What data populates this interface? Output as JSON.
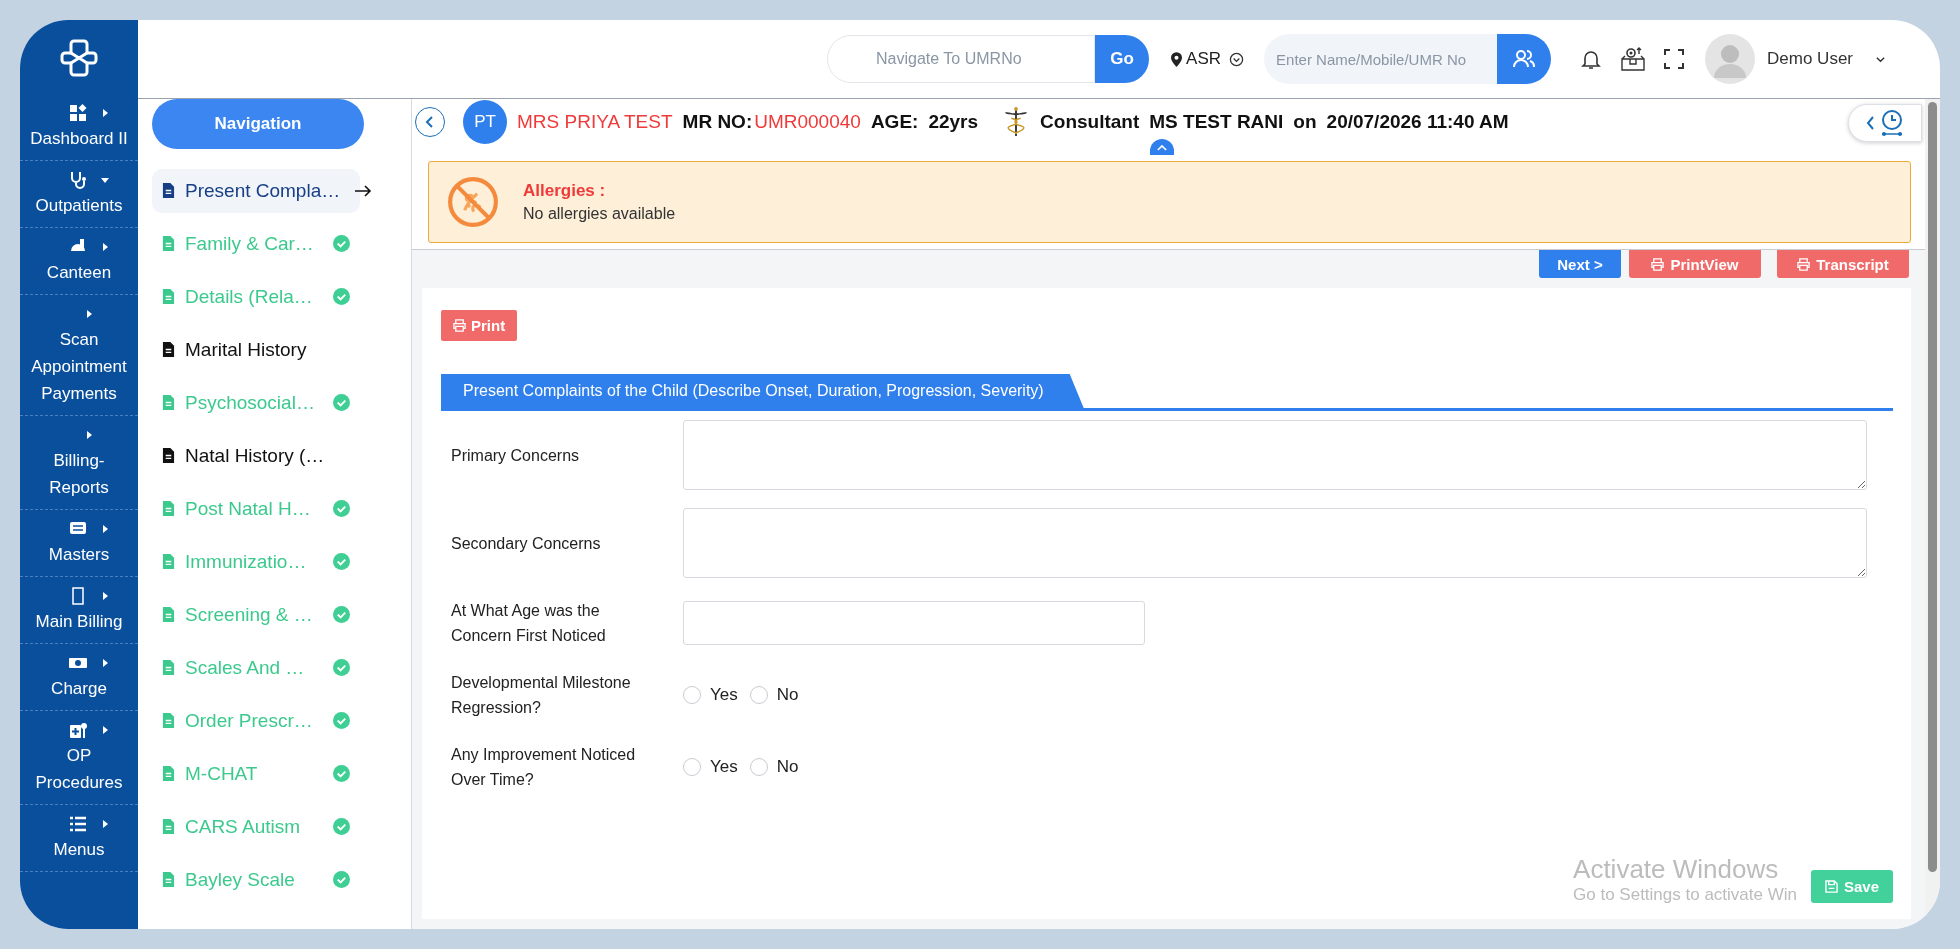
{
  "sidebar": {
    "items": [
      {
        "label": "Dashboard II",
        "expanded": false
      },
      {
        "label": "Outpatients",
        "expanded": true
      },
      {
        "label": "Canteen",
        "expanded": false
      },
      {
        "label": "Scan Appointment Payments",
        "expanded": false
      },
      {
        "label": "Billing-Reports",
        "expanded": false
      },
      {
        "label": "Masters",
        "expanded": false
      },
      {
        "label": "Main Billing",
        "expanded": false
      },
      {
        "label": "Charge",
        "expanded": false
      },
      {
        "label": "OP Procedures",
        "expanded": false
      },
      {
        "label": "Menus",
        "expanded": false
      }
    ]
  },
  "topbar": {
    "umr_search": {
      "placeholder": "Navigate To UMRNo",
      "button": "Go"
    },
    "location": "ASR",
    "patient_search": {
      "placeholder": "Enter Name/Mobile/UMR No"
    },
    "user": {
      "name": "Demo User"
    }
  },
  "navigation": {
    "title": "Navigation",
    "items": [
      {
        "label": "Present Compla…",
        "selected": true,
        "completed": false
      },
      {
        "label": "Family & Car…",
        "selected": false,
        "completed": true
      },
      {
        "label": "Details (Rela…",
        "selected": false,
        "completed": true
      },
      {
        "label": "Marital History",
        "selected": false,
        "completed": false
      },
      {
        "label": "Psychosocial…",
        "selected": false,
        "completed": true
      },
      {
        "label": "Natal History (…",
        "selected": false,
        "completed": false
      },
      {
        "label": "Post Natal H…",
        "selected": false,
        "completed": true
      },
      {
        "label": "Immunizatio…",
        "selected": false,
        "completed": true
      },
      {
        "label": "Screening & …",
        "selected": false,
        "completed": true
      },
      {
        "label": "Scales And …",
        "selected": false,
        "completed": true
      },
      {
        "label": "Order Prescr…",
        "selected": false,
        "completed": true
      },
      {
        "label": "M-CHAT",
        "selected": false,
        "completed": true
      },
      {
        "label": "CARS Autism",
        "selected": false,
        "completed": true
      },
      {
        "label": "Bayley Scale",
        "selected": false,
        "completed": true
      }
    ]
  },
  "patient": {
    "initials": "PT",
    "name": "MRS PRIYA TEST",
    "mr_label": "MR NO:",
    "mr_no": "UMR000040",
    "age_label": "AGE:",
    "age": "22yrs",
    "consultant_label": "Consultant",
    "consultant": "MS TEST RANI",
    "on_label": "on",
    "datetime": "20/07/2026 11:40 AM"
  },
  "allergies": {
    "title": "Allergies :",
    "text": "No allergies available"
  },
  "actions": [
    {
      "kind": "next",
      "label": "Next >"
    },
    {
      "kind": "print",
      "label": "PrintView"
    },
    {
      "kind": "print",
      "label": "Transcript"
    }
  ],
  "form": {
    "print_button": "Print",
    "section_title": "Present Complaints of the Child (Describe Onset, Duration, Progression, Severity)",
    "fields": [
      {
        "kind": "textarea",
        "label": "Primary Concerns"
      },
      {
        "kind": "textarea",
        "label": "Secondary Concerns"
      },
      {
        "kind": "text",
        "label": "At What Age was the Concern First Noticed"
      },
      {
        "kind": "radio",
        "label": "Developmental Milestone Regression?",
        "options": [
          {
            "label": "Yes",
            "selected": false
          },
          {
            "label": "No",
            "selected": false
          }
        ]
      },
      {
        "kind": "radio",
        "label": "Any Improvement Noticed Over Time?",
        "options": [
          {
            "label": "Yes",
            "selected": false
          },
          {
            "label": "No",
            "selected": false
          }
        ]
      }
    ],
    "save_button": "Save"
  },
  "os_notice": {
    "title": "Activate Windows",
    "text": "Go to Settings to activate Win"
  }
}
